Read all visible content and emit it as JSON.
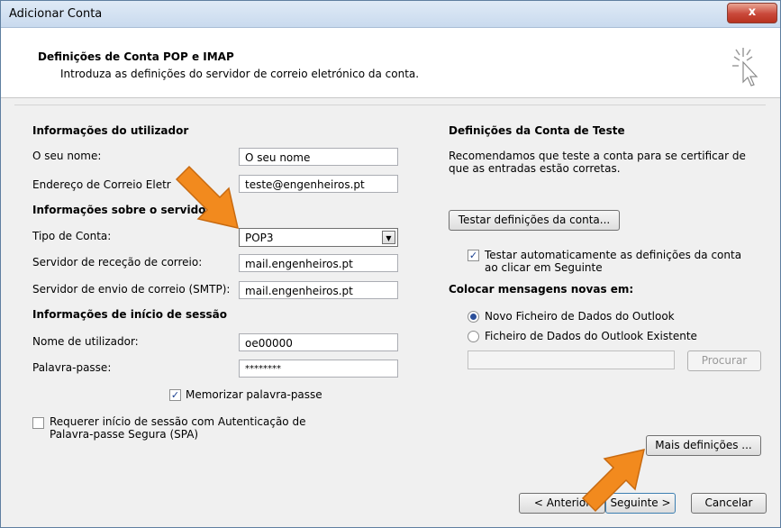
{
  "window": {
    "title": "Adicionar Conta",
    "close_glyph": "x"
  },
  "header": {
    "title": "Definições de Conta POP e IMAP",
    "subtitle": "Introduza as definições do servidor de correio eletrónico da conta."
  },
  "user_info": {
    "heading": "Informações do utilizador",
    "name_label": "O seu nome:",
    "name_value": "O seu nome",
    "email_label": "Endereço de Correio Eletr",
    "email_value": "teste@engenheiros.pt"
  },
  "server_info": {
    "heading": "Informações sobre o servidor",
    "account_type_label": "Tipo de Conta:",
    "account_type_value": "POP3",
    "incoming_label": "Servidor de receção de correio:",
    "incoming_value": "mail.engenheiros.pt",
    "outgoing_label": "Servidor de envio de correio (SMTP):",
    "outgoing_value": "mail.engenheiros.pt"
  },
  "login_info": {
    "heading": "Informações de início de sessão",
    "username_label": "Nome de utilizador:",
    "username_value": "oe00000",
    "password_label": "Palavra-passe:",
    "password_value": "********",
    "remember_label": "Memorizar palavra-passe",
    "remember_checked": true,
    "spa_label_line1": "Requerer início de sessão com Autenticação de",
    "spa_label_line2": "Palavra-passe Segura (SPA)",
    "spa_checked": false
  },
  "test_settings": {
    "heading": "Definições da Conta de Teste",
    "description_line1": "Recomendamos que teste a conta para se certificar de",
    "description_line2": "que as entradas estão corretas.",
    "test_button": "Testar definições da conta...",
    "auto_test_line1": "Testar automaticamente as definições da conta",
    "auto_test_line2": "ao clicar em Seguinte",
    "auto_test_checked": true
  },
  "deliver": {
    "heading": "Colocar mensagens novas em:",
    "option_new": "Novo Ficheiro de Dados do Outlook",
    "option_existing": "Ficheiro de Dados do Outlook Existente",
    "selected": "new",
    "path_value": "",
    "browse_button": "Procurar"
  },
  "buttons": {
    "more_settings": "Mais definições ...",
    "back": "< Anterior",
    "next": "Seguinte >",
    "cancel": "Cancelar"
  },
  "colors": {
    "arrow": "#f28a1e",
    "arrow_outline": "#c86a10"
  },
  "icons": [
    "close-icon",
    "wand-cursor-icon",
    "dropdown-arrow-icon",
    "checkmark-icon",
    "orange-arrow-annotation"
  ]
}
